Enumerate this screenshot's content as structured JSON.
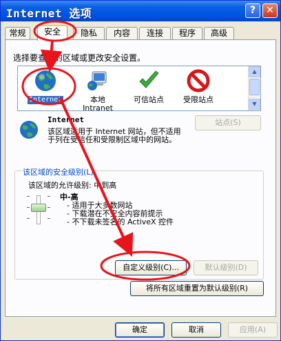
{
  "window": {
    "title": "Internet 选项",
    "help_glyph": "?",
    "close_glyph": "✕"
  },
  "tabs": [
    {
      "label": "常规"
    },
    {
      "label": "安全"
    },
    {
      "label": "隐私"
    },
    {
      "label": "内容"
    },
    {
      "label": "连接"
    },
    {
      "label": "程序"
    },
    {
      "label": "高级"
    }
  ],
  "security": {
    "prompt": "选择要查看的区域或更改安全设置。",
    "zones": [
      {
        "label": "Internet",
        "icon": "globe-icon"
      },
      {
        "label": "本地\nIntranet",
        "icon": "computer-globe-icon"
      },
      {
        "label": "可信站点",
        "icon": "checkmark-icon"
      },
      {
        "label": "受限站点",
        "icon": "no-entry-icon"
      }
    ],
    "zone_title": "Internet",
    "zone_desc": "该区域适用于 Internet 网站，但不适用于列在受信任和受限制区域中的网站。",
    "sites_button": "站点(S)",
    "level_group": "该区域的安全级别(L)",
    "allowed_levels": "该区域的允许级别: 中到高",
    "level_name": "中-高",
    "level_items": [
      "适用于大多数网站",
      "下载潜在不安全内容前提示",
      "不下载未签名的 ActiveX 控件"
    ],
    "custom_level_button": "自定义级别(C)...",
    "default_level_button": "默认级别(D)",
    "reset_all_button": "将所有区域重置为默认级别(R)"
  },
  "footer": {
    "ok": "确定",
    "cancel": "取消",
    "apply": "应用(A)"
  },
  "colors": {
    "annotation": "#e8141b",
    "titlebar": "#0054e3",
    "link_blue": "#0046d5"
  }
}
